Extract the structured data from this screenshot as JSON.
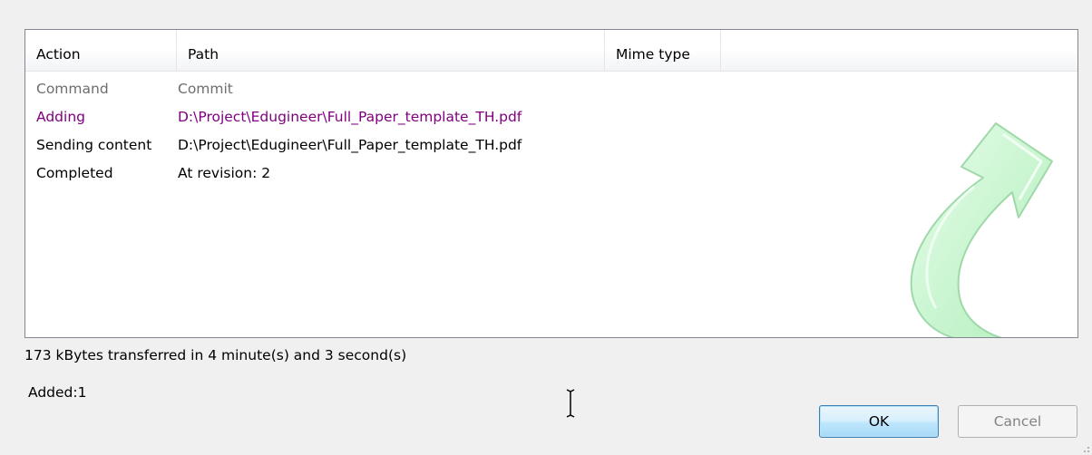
{
  "log_table": {
    "columns": {
      "action": "Action",
      "path": "Path",
      "mime_type": "Mime type"
    },
    "rows": [
      {
        "action": "Command",
        "path": "Commit",
        "color": "#6d6d6d"
      },
      {
        "action": "Adding",
        "path": "D:\\Project\\Edugineer\\Full_Paper_template_TH.pdf",
        "color": "#800080"
      },
      {
        "action": "Sending content",
        "path": "D:\\Project\\Edugineer\\Full_Paper_template_TH.pdf",
        "color": "#000000"
      },
      {
        "action": "Completed",
        "path": "At revision: 2",
        "color": "#000000"
      }
    ]
  },
  "graphic": {
    "icon": "commit-arrow-icon",
    "color": "#c8f5cf"
  },
  "status": {
    "transfer_summary": "173 kBytes transferred in 4 minute(s) and 3 second(s)",
    "added_summary": "Added:1"
  },
  "buttons": {
    "ok_label": "OK",
    "cancel_label": "Cancel"
  }
}
